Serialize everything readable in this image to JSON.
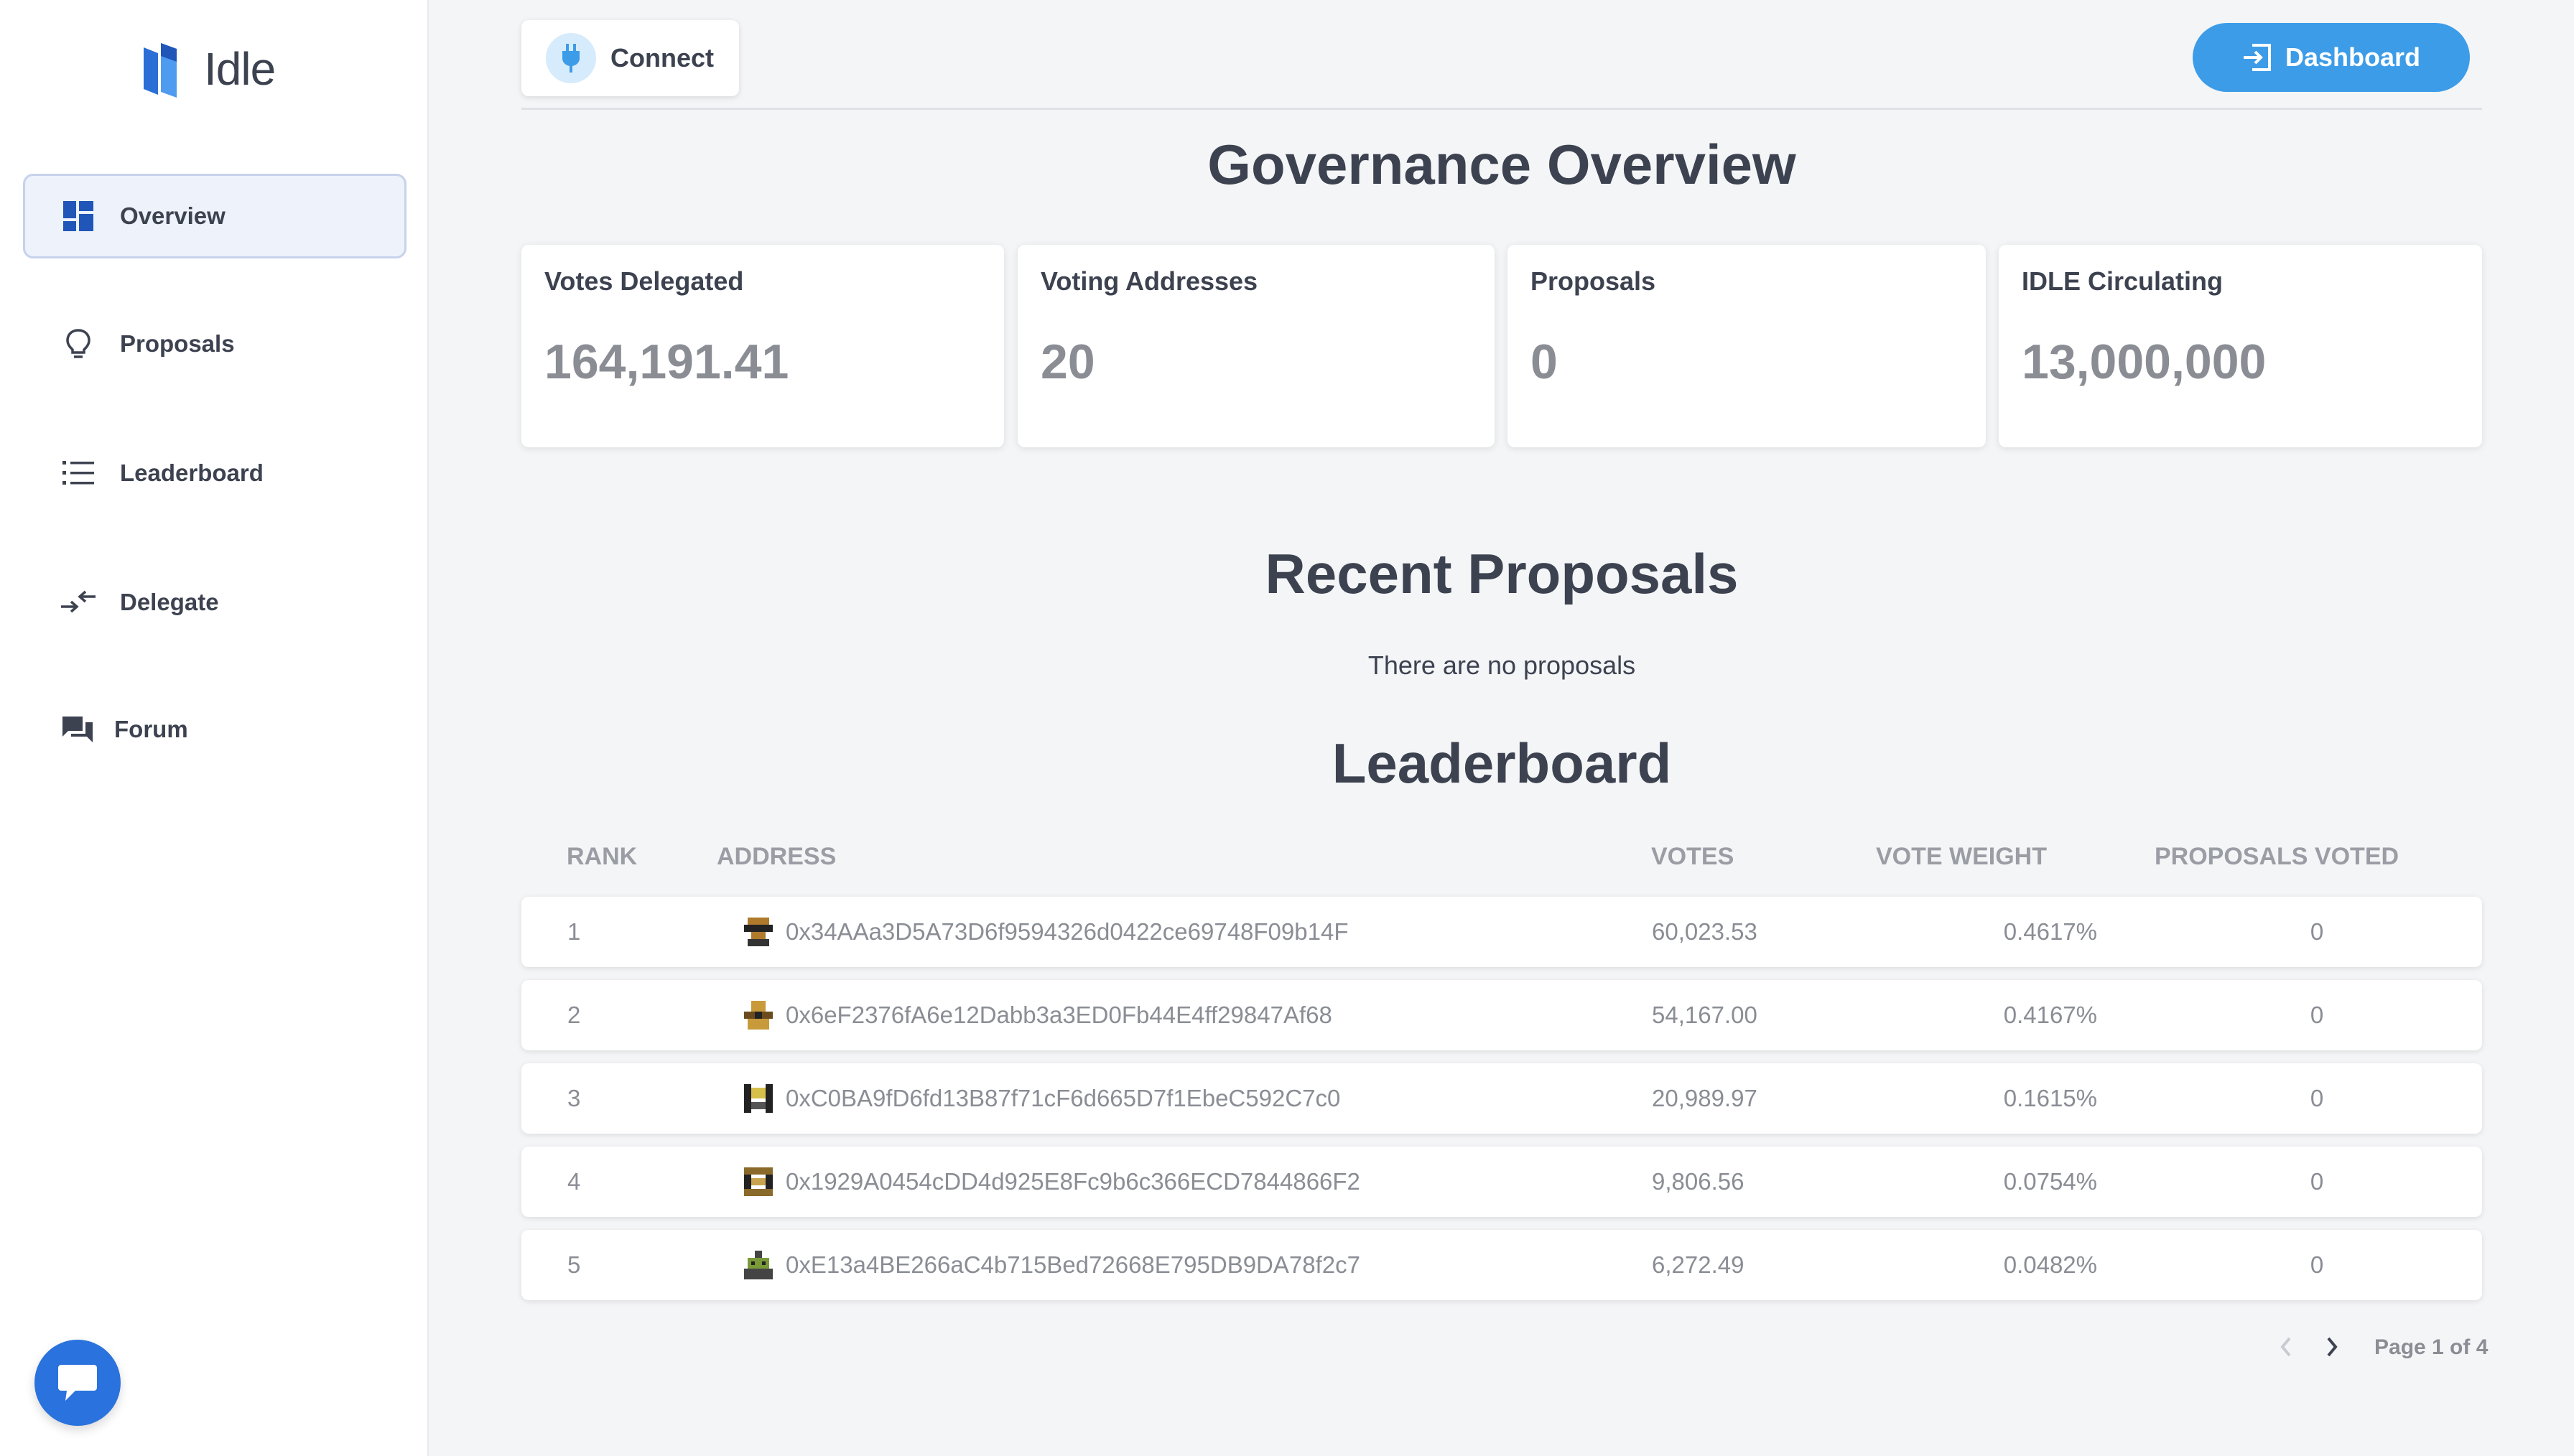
{
  "app": {
    "name": "Idle"
  },
  "sidebar": {
    "items": [
      {
        "label": "Overview",
        "icon": "dashboard-icon",
        "active": true
      },
      {
        "label": "Proposals",
        "icon": "lightbulb-icon"
      },
      {
        "label": "Leaderboard",
        "icon": "list-icon"
      },
      {
        "label": "Delegate",
        "icon": "delegate-arrows-icon"
      },
      {
        "label": "Forum",
        "icon": "forum-icon"
      }
    ]
  },
  "header": {
    "connect_label": "Connect",
    "dashboard_label": "Dashboard"
  },
  "overview": {
    "title": "Governance Overview",
    "stats": [
      {
        "label": "Votes Delegated",
        "value": "164,191.41"
      },
      {
        "label": "Voting Addresses",
        "value": "20"
      },
      {
        "label": "Proposals",
        "value": "0"
      },
      {
        "label": "IDLE Circulating",
        "value": "13,000,000"
      }
    ]
  },
  "proposals": {
    "title": "Recent Proposals",
    "empty_text": "There are no proposals"
  },
  "leaderboard": {
    "title": "Leaderboard",
    "columns": [
      "RANK",
      "ADDRESS",
      "VOTES",
      "VOTE WEIGHT",
      "PROPOSALS VOTED"
    ],
    "rows": [
      {
        "rank": "1",
        "address": "0x34AAa3D5A73D6f9594326d0422ce69748F09b14F",
        "votes": "60,023.53",
        "weight": "0.4617%",
        "proposals_voted": "0"
      },
      {
        "rank": "2",
        "address": "0x6eF2376fA6e12Dabb3a3ED0Fb44E4ff29847Af68",
        "votes": "54,167.00",
        "weight": "0.4167%",
        "proposals_voted": "0"
      },
      {
        "rank": "3",
        "address": "0xC0BA9fD6fd13B87f71cF6d665D7f1EbeC592C7c0",
        "votes": "20,989.97",
        "weight": "0.1615%",
        "proposals_voted": "0"
      },
      {
        "rank": "4",
        "address": "0x1929A0454cDD4d925E8Fc9b6c366ECD7844866F2",
        "votes": "9,806.56",
        "weight": "0.0754%",
        "proposals_voted": "0"
      },
      {
        "rank": "5",
        "address": "0xE13a4BE266aC4b715Bed72668E795DB9DA78f2c7",
        "votes": "6,272.49",
        "weight": "0.0482%",
        "proposals_voted": "0"
      }
    ],
    "pagination": {
      "text": "Page 1 of 4"
    }
  },
  "colors": {
    "accent": "#3d9ce8",
    "nav_active_bg": "#eef2fb",
    "chat_button": "#2a72dd"
  }
}
